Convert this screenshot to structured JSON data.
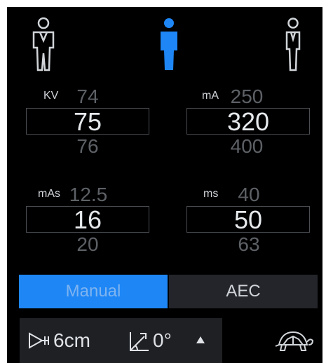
{
  "patient_size": {
    "options": [
      "small-patient-icon",
      "medium-patient-icon",
      "large-patient-icon"
    ],
    "selected": "medium-patient-icon",
    "selected_color": "#1e86f5"
  },
  "kv": {
    "label": "KV",
    "prev": "74",
    "value": "75",
    "next": "76"
  },
  "ma": {
    "label": "mA",
    "prev": "250",
    "value": "320",
    "next": "400"
  },
  "mas": {
    "label": "mAs",
    "prev": "12.5",
    "value": "16",
    "next": "20"
  },
  "ms": {
    "label": "ms",
    "prev": "40",
    "value": "50",
    "next": "63"
  },
  "mode": {
    "manual_label": "Manual",
    "aec_label": "AEC",
    "selected": "Manual",
    "accent": "#1e86f5"
  },
  "bottom": {
    "distance": "6cm",
    "angle": "0°",
    "speed_icon": "turtle-icon"
  }
}
